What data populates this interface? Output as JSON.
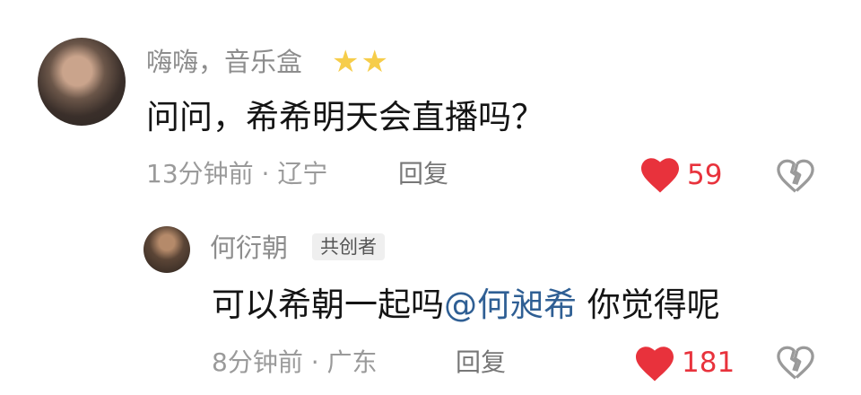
{
  "comments": [
    {
      "username": "嗨嗨，音乐盒",
      "content": "问问，希希明天会直播吗？",
      "meta": "13分钟前 · 辽宁",
      "reply_label": "回复",
      "likes": "59",
      "star_count": 2
    }
  ],
  "replies": [
    {
      "username": "何衍朝",
      "badge": "共创者",
      "content_prefix": "可以希朝一起吗",
      "mention": "@何昶希",
      "content_suffix": " 你觉得呢",
      "meta": "8分钟前 · 广东",
      "reply_label": "回复",
      "likes": "181"
    }
  ],
  "colors": {
    "like": "#e8323c",
    "mention": "#2f5f94",
    "star": "#f6cd4a"
  }
}
